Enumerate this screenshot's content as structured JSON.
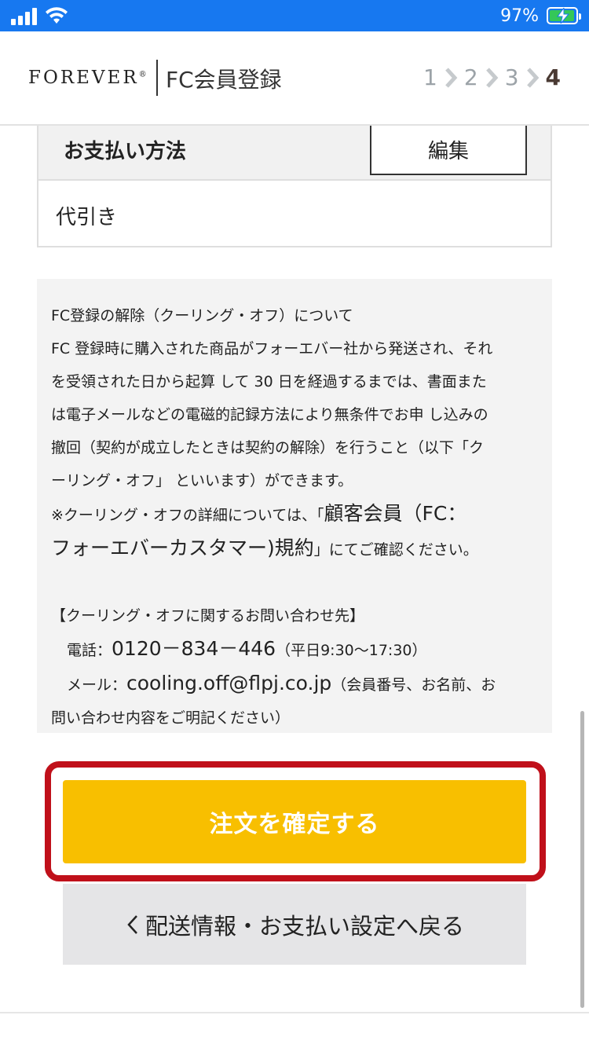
{
  "status_bar": {
    "battery_percent": "97%",
    "battery_level": 0.97,
    "colors": {
      "bar": "#1778f0",
      "battery_fill": "#34c759"
    }
  },
  "header": {
    "logo": "FOREVER",
    "logo_mark": "®",
    "title": "FC会員登録",
    "steps": [
      "1",
      "2",
      "3",
      "4"
    ],
    "current_step": "4"
  },
  "payment": {
    "heading": "お支払い方法",
    "edit_label": "編集",
    "value": "代引き"
  },
  "cooling_off": {
    "line1": "FC登録の解除（クーリング・オフ）について",
    "line2": "FC 登録時に購入された商品がフォーエバー社から発送され、それ",
    "line3": "を受領された日から起算 して 30 日を経過するまでは、書面また",
    "line4": "は電子メールなどの電磁的記録方法により無条件でお申 し込みの",
    "line5": "撤回（契約が成立したときは契約の解除）を行うこと（以下「ク",
    "line6": "ーリング・オフ」 といいます）ができます。",
    "line7_prefix": "※クーリング・オフの詳細については、「",
    "line7_big": "顧客会員（FC：",
    "line8_big": "フォーエバーカスタマー)規約",
    "line8_suffix": "」にてご確認ください。",
    "contact_heading": "【クーリング・オフに関するお問い合わせ先】",
    "phone_label": "電話：",
    "phone_number": "0120－834－446",
    "phone_hours": "（平日9:30～17:30）",
    "mail_label": "メール：",
    "mail_address": "cooling.off@flpj.co.jp",
    "mail_note1": "（会員番号、お名前、お",
    "mail_note2": "問い合わせ内容をご明記ください）"
  },
  "actions": {
    "confirm_label": "注文を確定する",
    "back_label": "配送情報・お支払い設定へ戻る",
    "colors": {
      "confirm": "#f8bf00",
      "highlight": "#c0101a",
      "back": "#e5e5e7"
    }
  }
}
